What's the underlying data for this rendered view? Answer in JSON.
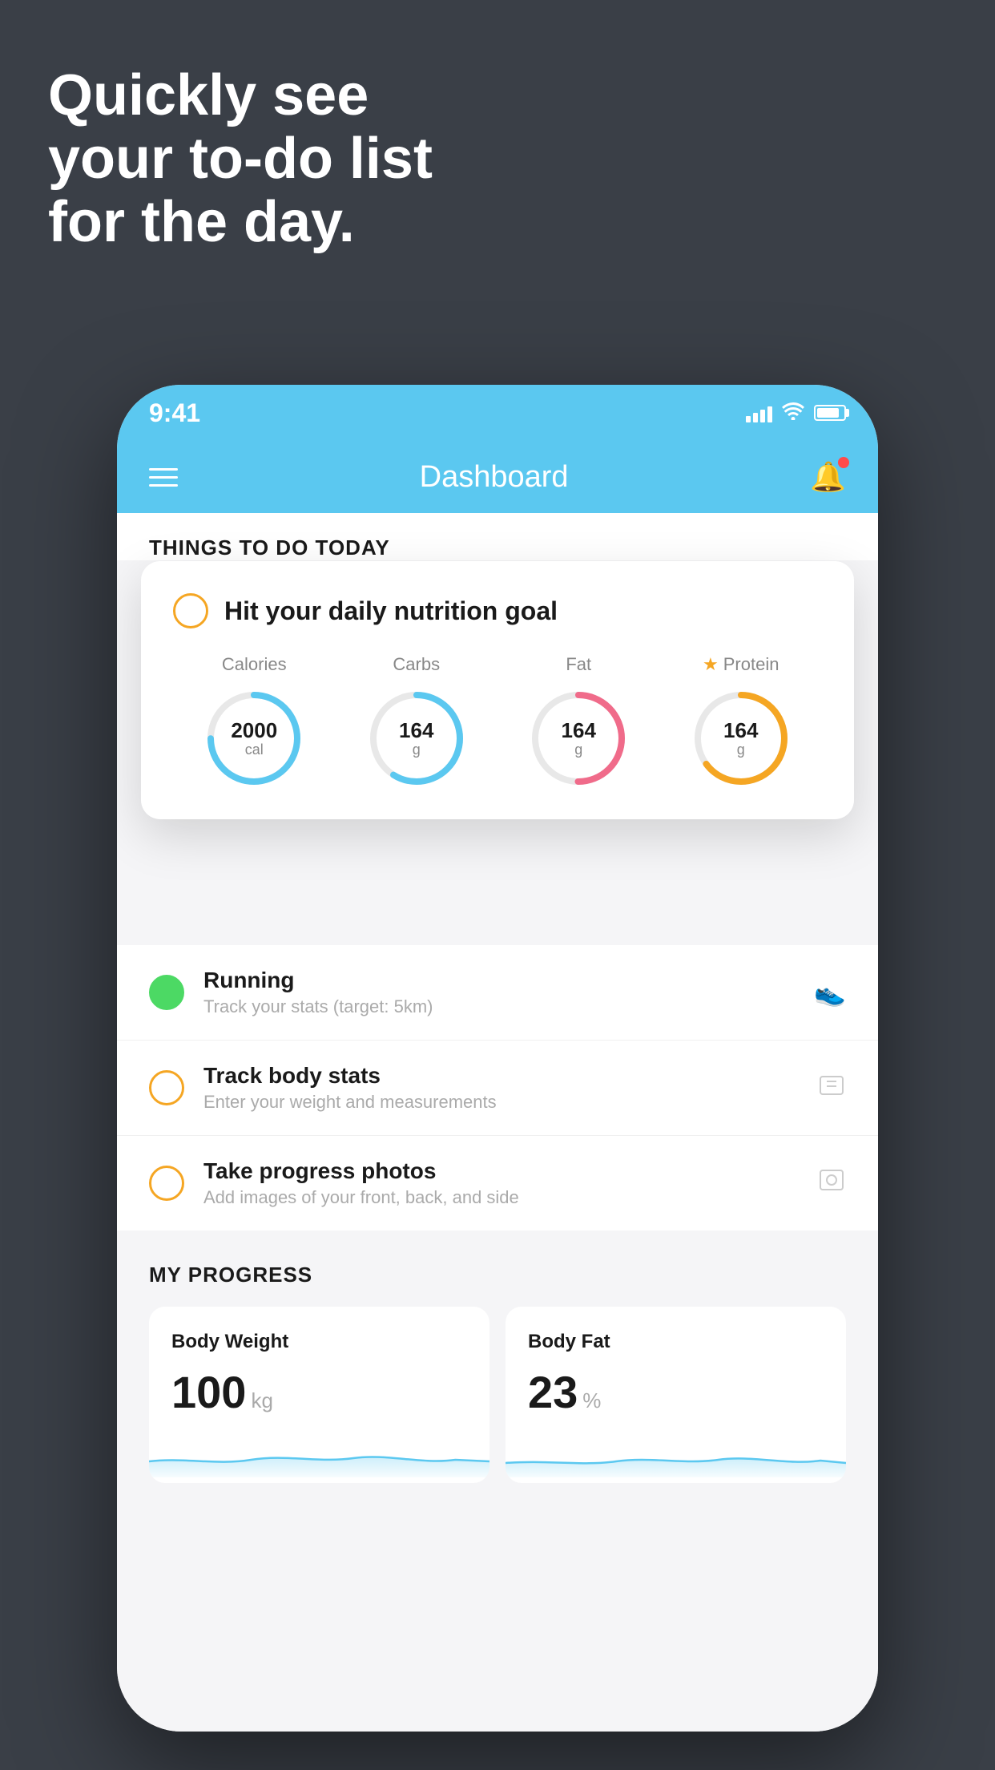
{
  "headline": {
    "line1": "Quickly see",
    "line2": "your to-do list",
    "line3": "for the day."
  },
  "status_bar": {
    "time": "9:41"
  },
  "app_header": {
    "title": "Dashboard"
  },
  "things_section": {
    "title": "THINGS TO DO TODAY"
  },
  "floating_card": {
    "title": "Hit your daily nutrition goal",
    "items": [
      {
        "label": "Calories",
        "value": "2000",
        "unit": "cal",
        "color": "blue",
        "star": false
      },
      {
        "label": "Carbs",
        "value": "164",
        "unit": "g",
        "color": "blue",
        "star": false
      },
      {
        "label": "Fat",
        "value": "164",
        "unit": "g",
        "color": "red",
        "star": false
      },
      {
        "label": "Protein",
        "value": "164",
        "unit": "g",
        "color": "yellow",
        "star": true
      }
    ]
  },
  "todo_items": [
    {
      "label": "Running",
      "sub": "Track your stats (target: 5km)",
      "circle": "green",
      "icon": "👟"
    },
    {
      "label": "Track body stats",
      "sub": "Enter your weight and measurements",
      "circle": "yellow",
      "icon": "⊡"
    },
    {
      "label": "Take progress photos",
      "sub": "Add images of your front, back, and side",
      "circle": "yellow",
      "icon": "👤"
    }
  ],
  "progress_section": {
    "title": "MY PROGRESS",
    "cards": [
      {
        "title": "Body Weight",
        "value": "100",
        "unit": "kg"
      },
      {
        "title": "Body Fat",
        "value": "23",
        "unit": "%"
      }
    ]
  }
}
